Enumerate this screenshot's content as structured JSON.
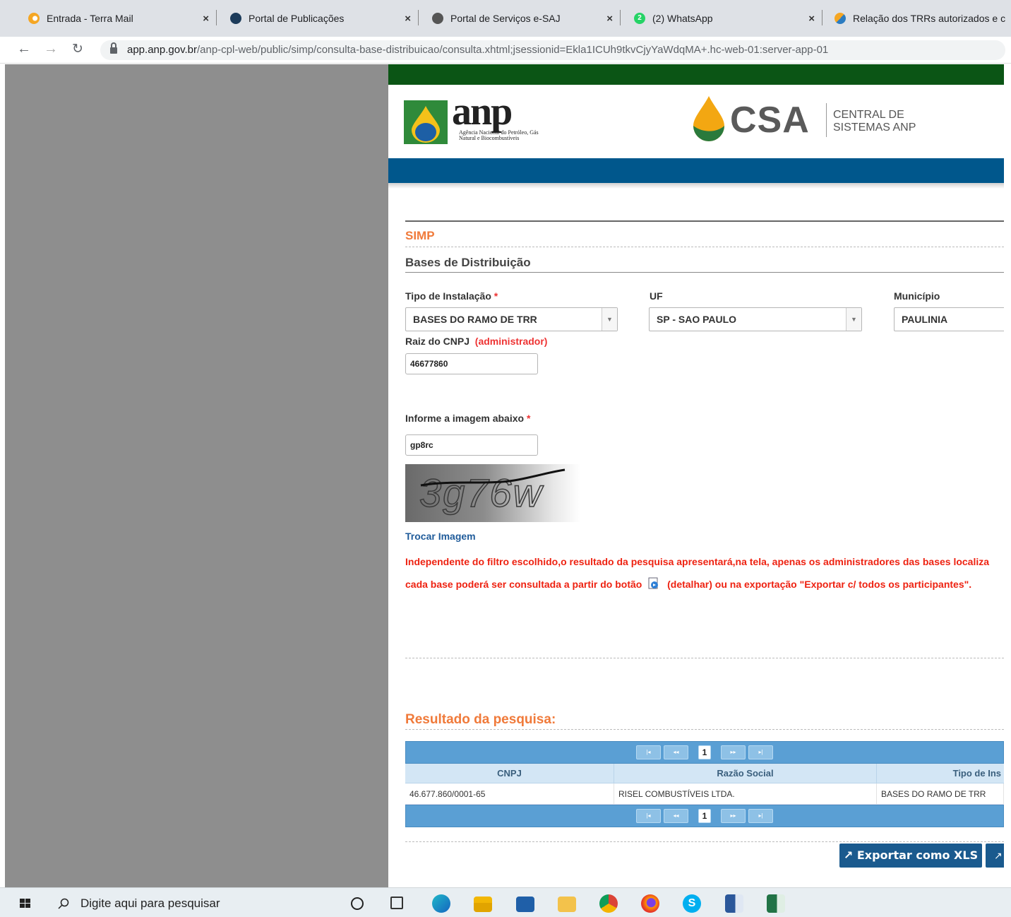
{
  "tabs": [
    {
      "label": "Entrada - Terra Mail",
      "favicon": "terra-icon",
      "color": "#f5a623"
    },
    {
      "label": "Portal de Publicações",
      "favicon": "portal-icon",
      "color": "#1c3b5a"
    },
    {
      "label": "Portal de Serviços e-SAJ",
      "favicon": "globe-icon",
      "color": "#555555"
    },
    {
      "label": "(2) WhatsApp",
      "favicon": "whatsapp-icon",
      "badge": "2",
      "color": "#25d366"
    },
    {
      "label": "Relação dos TRRs autorizados e c",
      "favicon": "anp-tab-icon",
      "color": "#2c7cc1"
    }
  ],
  "address": {
    "host": "app.anp.gov.br",
    "path": "/anp-cpl-web/public/simp/consulta-base-distribuicao/consulta.xhtml;jsessionid=Ekla1ICUh9tkvCjyYaWdqMA+.hc-web-01:server-app-01"
  },
  "header": {
    "anp_word": "anp",
    "anp_subtitle": "Agência Nacional do Petróleo, Gás Natural e Biocombustíveis",
    "csa_word": "CSA",
    "csa_line1": "CENTRAL DE",
    "csa_line2": "SISTEMAS ANP"
  },
  "page": {
    "section": "SIMP",
    "title": "Bases de Distribuição"
  },
  "form": {
    "tipo_label": "Tipo de Instalação",
    "tipo_value": "BASES DO RAMO DE TRR",
    "uf_label": "UF",
    "uf_value": "SP - SAO PAULO",
    "municipio_label": "Município",
    "municipio_value": "PAULINIA",
    "cnpj_label": "Raiz do CNPJ",
    "cnpj_note": "(administrador)",
    "cnpj_value": "46677860",
    "captcha_label": "Informe a imagem abaixo",
    "captcha_value": "gp8rc",
    "captcha_image_text": "3g76w",
    "required_mark": "*",
    "change_image": "Trocar Imagem"
  },
  "notice": {
    "line1": "Independente do filtro escolhido,o resultado da pesquisa apresentará,na tela, apenas os administradores das bases localiza",
    "line2_before": "cada base poderá ser consultada a partir do botão",
    "line2_after": "(detalhar) ou na exportação \"Exportar c/ todos os participantes\"."
  },
  "results": {
    "title": "Resultado da pesquisa:",
    "pager": {
      "first": "|◂",
      "prev": "◂◂",
      "current": "1",
      "next": "▸▸",
      "last": "▸|"
    },
    "columns": [
      "CNPJ",
      "Razão Social",
      "Tipo de Ins"
    ],
    "rows": [
      [
        "46.677.860/0001-65",
        "RISEL COMBUSTÍVEIS LTDA.",
        "BASES DO RAMO DE TRR"
      ]
    ],
    "export_xls": "↗ Exportar como XLS",
    "export_all": "↗"
  },
  "taskbar": {
    "search_placeholder": "Digite aqui para pesquisar"
  }
}
